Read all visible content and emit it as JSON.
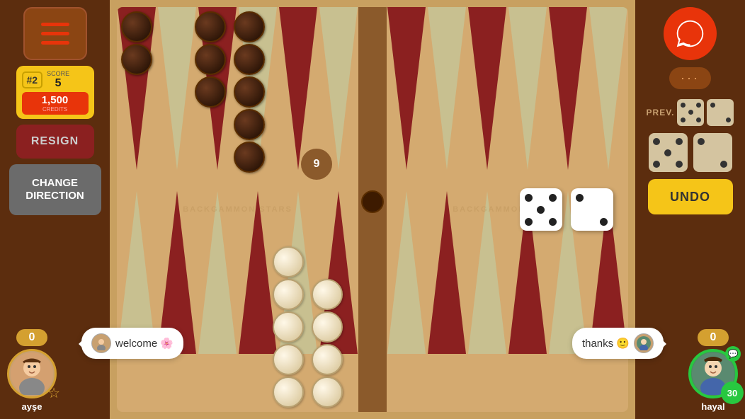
{
  "left_panel": {
    "menu_label": "Menu",
    "rank": "#2",
    "score_label": "SCORE",
    "score_value": "5",
    "credits_value": "1,500",
    "credits_label": "CREDITS",
    "resign_label": "RESIGN",
    "change_dir_label": "CHANGE DIRECTION"
  },
  "right_panel": {
    "prev_label": "PREV.",
    "undo_label": "UNDO",
    "dots": "···"
  },
  "board": {
    "watermark": "BACKGAMMON STARS",
    "dice1_value": "5",
    "dice2_value": "2"
  },
  "player_left": {
    "name": "ayşe",
    "score": "0",
    "chat_message": "welcome 🌸"
  },
  "player_right": {
    "name": "hayal",
    "score": "0",
    "timer": "30",
    "chat_message": "thanks 🙂"
  }
}
